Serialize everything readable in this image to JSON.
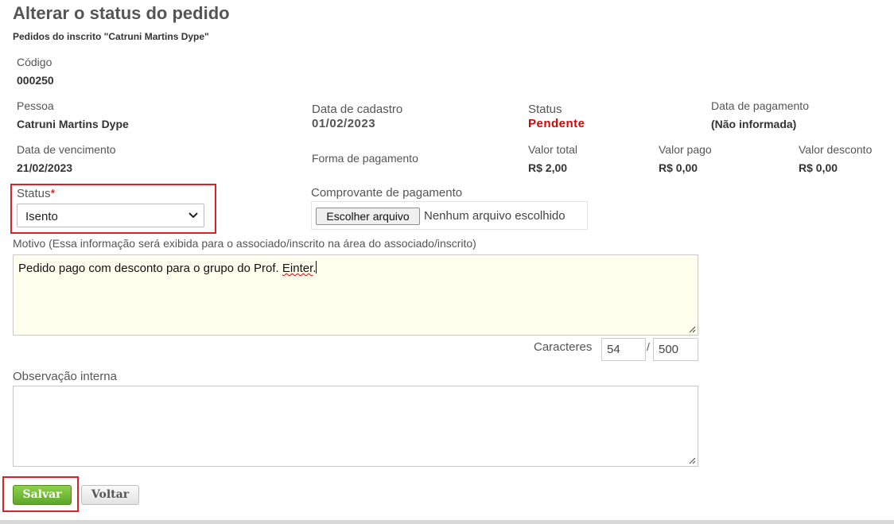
{
  "page": {
    "title": "Alterar o status do pedido",
    "subtitle": "Pedidos do inscrito \"Catruni Martins Dype\""
  },
  "details": {
    "codigo": {
      "label": "Código",
      "value": "000250"
    },
    "pessoa": {
      "label": "Pessoa",
      "value": "Catruni Martins Dype"
    },
    "data_cadastro": {
      "label": "Data de cadastro",
      "value": "01/02/2023"
    },
    "status": {
      "label": "Status",
      "value": "Pendente",
      "color": "#dd0000"
    },
    "data_pagamento": {
      "label": "Data de pagamento",
      "value": "(Não informada)"
    },
    "data_vencimento": {
      "label": "Data de vencimento",
      "value": "21/02/2023"
    },
    "forma_pagamento": {
      "label": "Forma de pagamento",
      "value": ""
    },
    "valor_total": {
      "label": "Valor total",
      "value": "R$ 2,00"
    },
    "valor_pago": {
      "label": "Valor pago",
      "value": "R$ 0,00"
    },
    "valor_desconto": {
      "label": "Valor desconto",
      "value": "R$ 0,00"
    }
  },
  "form": {
    "status_field": {
      "label": "Status",
      "required_mark": "*",
      "selected": "Isento"
    },
    "comprovante": {
      "label": "Comprovante de pagamento",
      "button_label": "Escolher arquivo",
      "no_file_text": "Nenhum arquivo escolhido"
    },
    "motivo": {
      "label": "Motivo (Essa informação será exibida para o associado/inscrito na área do associado/inscrito)",
      "value_prefix": "Pedido pago com desconto para o grupo do Prof. ",
      "value_misspelled": "Einter",
      "value_suffix": "."
    },
    "char_count": {
      "label": "Caracteres",
      "current": "54",
      "separator": "/",
      "max": "500"
    },
    "observacao": {
      "label": "Observação interna",
      "value": ""
    }
  },
  "actions": {
    "save_label": "Salvar",
    "back_label": "Voltar"
  },
  "colors": {
    "highlight": "#d9232a",
    "save_button": "#6bb32f",
    "textarea_bg": "#ffffee"
  },
  "icons": {
    "select_arrow": "chevron-down-icon",
    "resize": "resize-grip-icon"
  }
}
